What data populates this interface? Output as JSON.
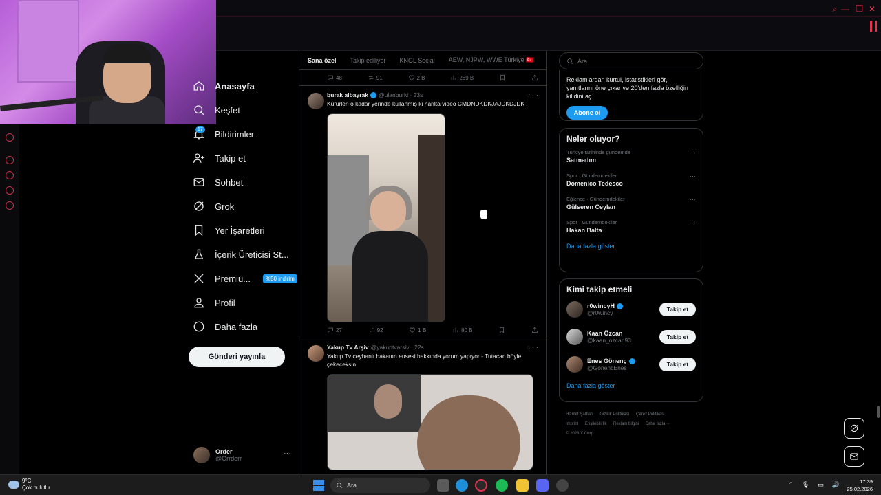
{
  "browser": {
    "controls": [
      "⌕",
      "—",
      "❐",
      "✕"
    ]
  },
  "nav": {
    "items": [
      {
        "label": "Anasayfa",
        "icon": "home-icon"
      },
      {
        "label": "Keşfet",
        "icon": "search-icon"
      },
      {
        "label": "Bildirimler",
        "icon": "bell-icon",
        "badge": "17"
      },
      {
        "label": "Takip et",
        "icon": "person-add-icon"
      },
      {
        "label": "Sohbet",
        "icon": "mail-icon"
      },
      {
        "label": "Grok",
        "icon": "grok-icon"
      },
      {
        "label": "Yer İşaretleri",
        "icon": "bookmark-icon"
      },
      {
        "label": "İçerik Üreticisi St...",
        "icon": "creator-icon"
      },
      {
        "label": "Premiu...",
        "icon": "x-logo-icon",
        "badge": "%50 indirim"
      },
      {
        "label": "Profil",
        "icon": "profile-icon"
      },
      {
        "label": "Daha fazla",
        "icon": "more-circle-icon"
      }
    ],
    "post_button": "Gönderi yayınla",
    "account": {
      "name": "Order",
      "handle": "@Orrderr"
    }
  },
  "timeline": {
    "tabs": [
      "Sana özel",
      "Takip ediliyor",
      "KNGL Social",
      "AEW, NJPW, WWE Türkiye 🇹🇷"
    ],
    "prev_actions": {
      "replies": "48",
      "reposts": "91",
      "likes": "2 B",
      "views": "269 B"
    },
    "tweets": [
      {
        "name": "burak albayrak",
        "handle": "@ulanburki · 23s",
        "text": "Küfürleri o kadar yerinde kullanmış ki harika video CMDNDKDKJAJDKDJDK",
        "actions": {
          "replies": "27",
          "reposts": "92",
          "likes": "1 B",
          "views": "80 B"
        }
      },
      {
        "name": "Yakup Tv Arşiv",
        "handle": "@yakuptvarsiv · 22s",
        "text": "Yakup Tv ceyhanlı hakanın ensesi hakkında yorum yapıyor - Tutacan böyle çekeceksin"
      }
    ]
  },
  "right": {
    "search_placeholder": "Ara",
    "premium_text": "Reklamlardan kurtul, istatistikleri gör, yanıtlarını öne çıkar ve 20'den fazla özelliğin kilidini aç.",
    "subscribe_label": "Abone ol",
    "trends_title": "Neler oluyor?",
    "trends": [
      {
        "context": "Türkiye tarihinde gündemde",
        "title": "Satmadım"
      },
      {
        "context": "Spor · Gündemdekiler",
        "title": "Domenico Tedesco"
      },
      {
        "context": "Eğlence · Gündemdekiler",
        "title": "Gülseren Ceylan"
      },
      {
        "context": "Spor · Gündemdekiler",
        "title": "Hakan Balta"
      }
    ],
    "show_more": "Daha fazla göster",
    "who_title": "Kimi takip etmeli",
    "who": [
      {
        "name": "r0wincyH",
        "handle": "@r0wincy",
        "verified": true
      },
      {
        "name": "Kaan Özcan",
        "handle": "@kaan_ozcan93",
        "verified": false
      },
      {
        "name": "Enes Gönenç",
        "handle": "@GonencEnes",
        "verified": true
      }
    ],
    "follow_label": "Takip et",
    "footer": [
      "Hizmet Şartları",
      "Gizlilik Politikası",
      "Çerez Politikası",
      "Imprint",
      "Erişilebilirlik",
      "Reklam bilgisi",
      "Daha fazla ···",
      "© 2026 X Corp."
    ]
  },
  "taskbar": {
    "temp": "9°C",
    "weather": "Çok bulutlu",
    "search": "Ara",
    "time": "17:39",
    "date": "25.02.2026"
  },
  "colors": {
    "accent": "#1d9bf0",
    "background": "#000000",
    "border": "#2f3336",
    "muted": "#71767b",
    "recording_red": "#e0334e"
  }
}
